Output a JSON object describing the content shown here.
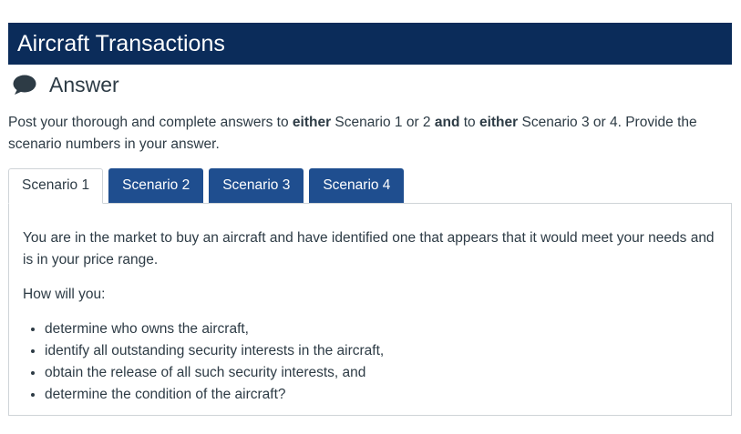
{
  "header": {
    "title": "Aircraft Transactions"
  },
  "answer": {
    "icon": "speech-bubble-icon",
    "title": "Answer"
  },
  "instructions": {
    "t1": "Post your thorough and complete answers to ",
    "b1": "either",
    "t2": " Scenario 1 or 2 ",
    "b2": "and",
    "t3": " to ",
    "b3": "either",
    "t4": " Scenario 3 or 4. Provide the scenario numbers in your answer."
  },
  "tabs": [
    {
      "label": "Scenario 1",
      "active": true
    },
    {
      "label": "Scenario 2",
      "active": false
    },
    {
      "label": "Scenario 3",
      "active": false
    },
    {
      "label": "Scenario 4",
      "active": false
    }
  ],
  "panel": {
    "intro": "You are in the market to buy an aircraft and have identified one that appears that it would meet your needs and is in your price range.",
    "question": "How will you:",
    "bullets": [
      "determine who owns the aircraft,",
      "identify all outstanding security interests in the aircraft,",
      "obtain the release of all such security interests, and",
      "determine the condition of the aircraft?"
    ]
  },
  "colors": {
    "banner": "#0b2c5a",
    "tab_inactive": "#1f4e8f",
    "text": "#2d3b45"
  }
}
